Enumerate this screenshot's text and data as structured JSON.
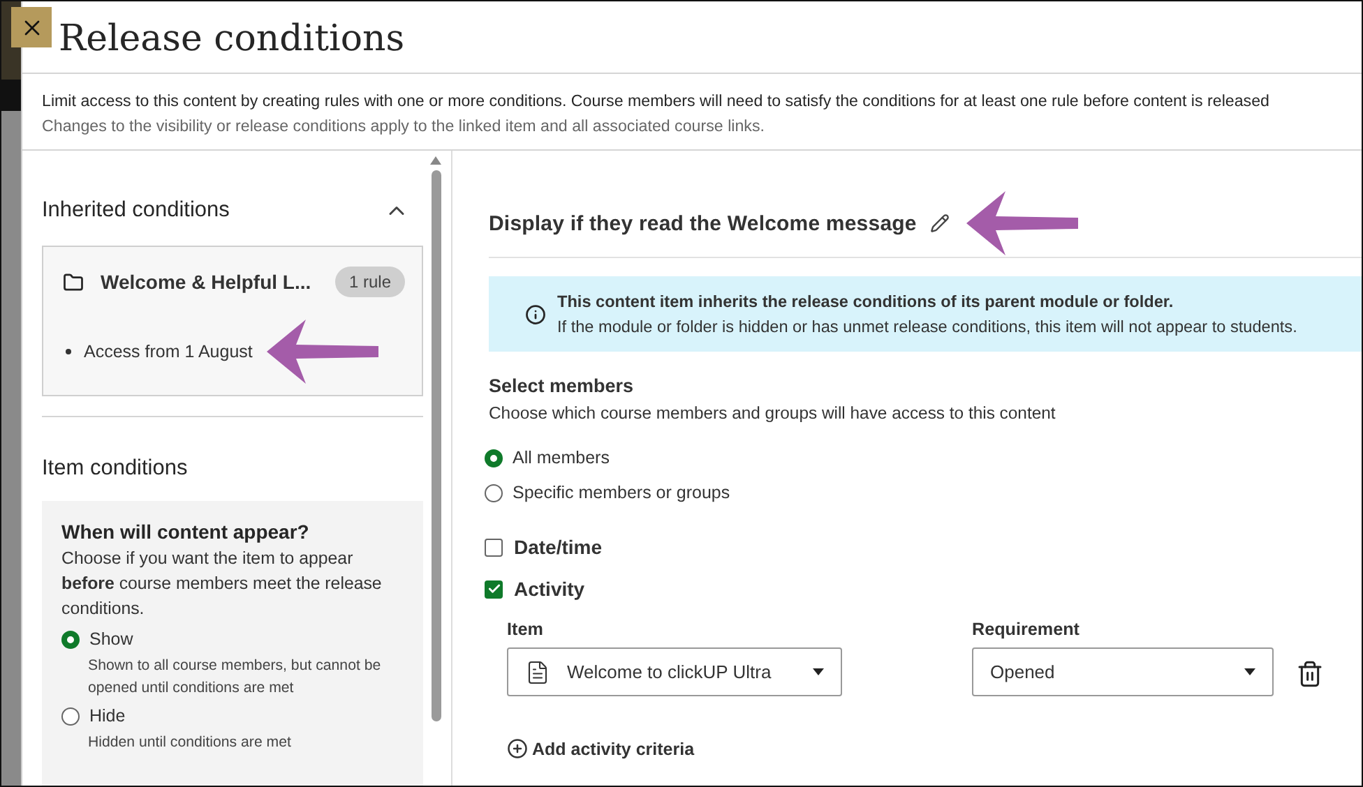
{
  "dialog": {
    "title": "Release conditions",
    "description": [
      "Limit access to this content by creating rules with one or more conditions. Course members will need to satisfy the conditions for at least one rule before content is released",
      "Changes to the visibility or release conditions apply to the linked item and all associated course links."
    ]
  },
  "inherited": {
    "heading": "Inherited conditions",
    "expanded": true,
    "folder": {
      "title": "Welcome & Helpful L...",
      "badge": "1 rule",
      "conditions": [
        "Access from 1 August"
      ]
    }
  },
  "item_conditions": {
    "heading": "Item conditions",
    "question": "When will content appear?",
    "help": "Choose if you want the item to appear **before** course members meet the release conditions.",
    "options": [
      {
        "label": "Show",
        "hint": "Shown to all course members, but cannot be opened until conditions are met",
        "selected": true
      },
      {
        "label": "Hide",
        "hint": "Hidden until conditions are met",
        "selected": false
      }
    ]
  },
  "rule": {
    "title": "Display if they read the Welcome message",
    "notice": {
      "title": "This content item inherits the release conditions of its parent module or folder.",
      "text": "If the module or folder is hidden or has unmet release conditions, this item will not appear to students."
    },
    "members": {
      "heading": "Select members",
      "hint": "Choose which course members and groups will have access to this content",
      "options": [
        {
          "label": "All members",
          "selected": true
        },
        {
          "label": "Specific members or groups",
          "selected": false
        }
      ]
    },
    "criteria": [
      {
        "label": "Date/time",
        "checked": false
      },
      {
        "label": "Activity",
        "checked": true,
        "fields": {
          "item_label": "Item",
          "item_value": "Welcome to clickUP Ultra",
          "requirement_label": "Requirement",
          "requirement_value": "Opened",
          "add_label": "Add activity criteria"
        }
      }
    ]
  }
}
